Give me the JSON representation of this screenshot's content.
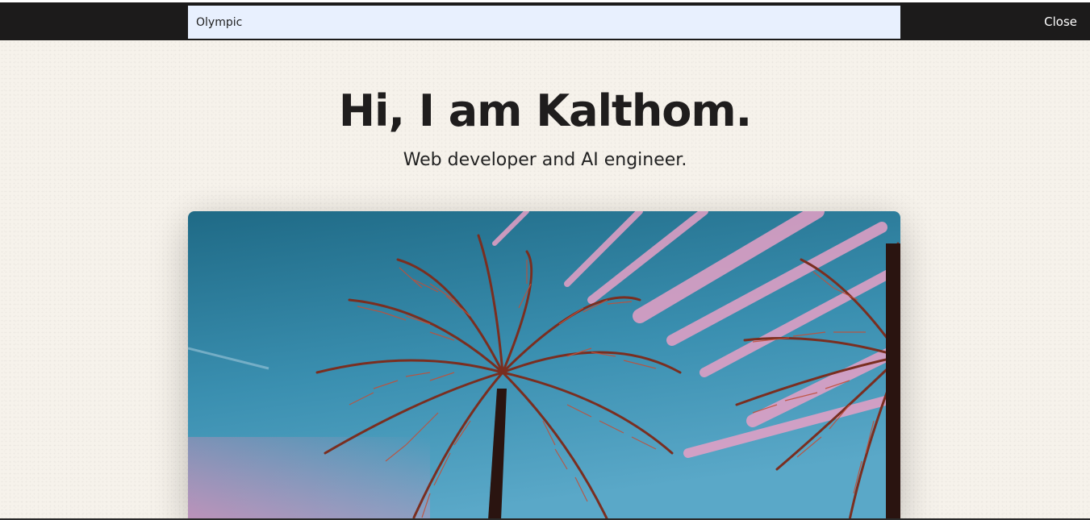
{
  "topbar": {
    "search_value": "Olympic",
    "close_label": "Close"
  },
  "hero": {
    "title": "Hi, I am Kalthom.",
    "subtitle": "Web developer and AI engineer."
  },
  "image": {
    "subject": "palm-trees-sunset-sky"
  }
}
